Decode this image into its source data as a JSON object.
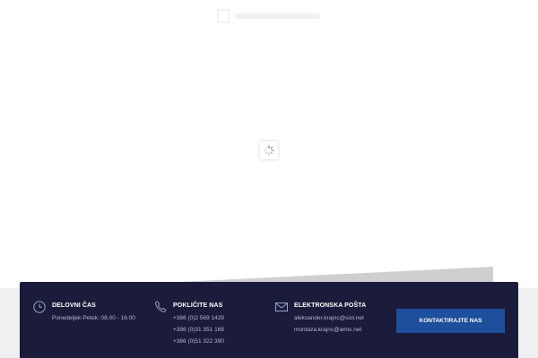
{
  "colors": {
    "contact_bar_bg": "#1b1c3b",
    "cta_bg": "#1d4f9c",
    "footer_bg": "#f0f0f2",
    "wedge": "#cfcfd2"
  },
  "contact": {
    "hours": {
      "icon": "clock-icon",
      "title": "DELOVNI ČAS",
      "lines": [
        "Ponedeljek-Petek: 08.00 - 16.00"
      ]
    },
    "phone": {
      "icon": "phone-icon",
      "title": "POKLIČITE NAS",
      "lines": [
        "+386 (0)2 569 1429",
        "+386 (0)31 351 168",
        "+386 (0)51 322 390"
      ]
    },
    "email": {
      "icon": "envelope-icon",
      "title": "ELEKTRONSKA POŠTA",
      "lines": [
        "aleksander.krajnc@siol.net",
        "montaza.krajnc@amis.net"
      ]
    },
    "cta_label": "KONTAKTIRAJTE NAS"
  }
}
